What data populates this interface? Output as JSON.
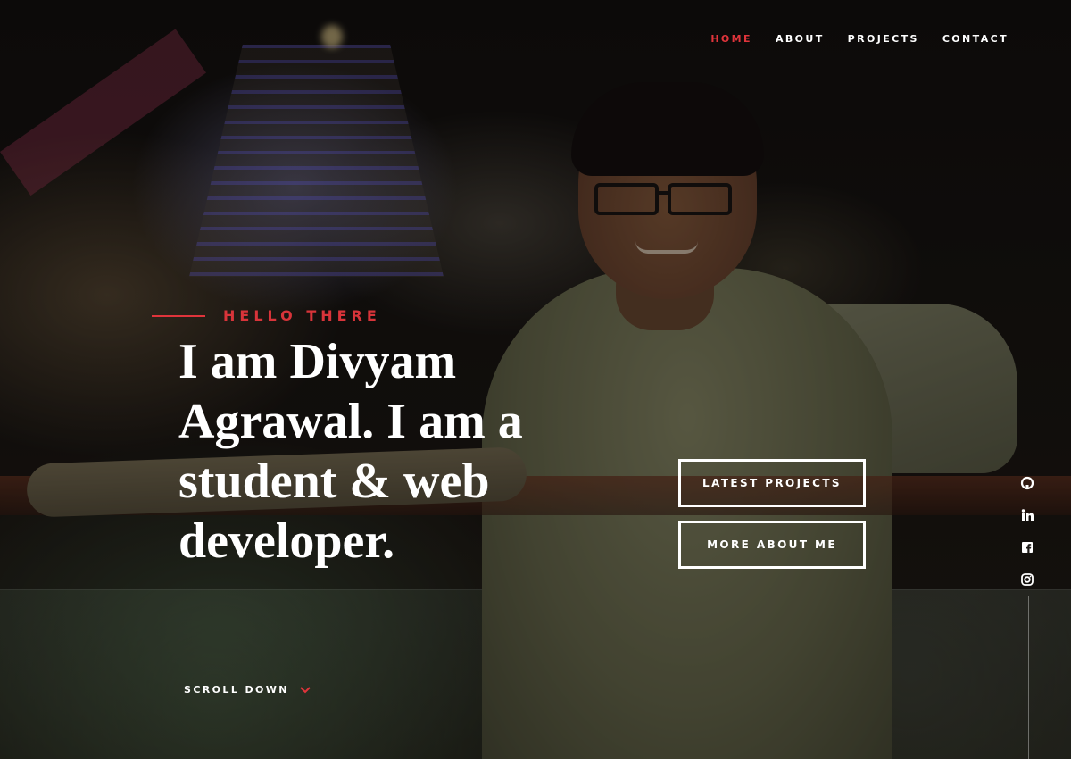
{
  "nav": {
    "items": [
      {
        "label": "HOME",
        "active": true
      },
      {
        "label": "ABOUT",
        "active": false
      },
      {
        "label": "PROJECTS",
        "active": false
      },
      {
        "label": "CONTACT",
        "active": false
      }
    ]
  },
  "hero": {
    "eyebrow": "HELLO THERE",
    "headline_lines": [
      "I am Divyam",
      "Agrawal. I am a",
      "student & web",
      "developer."
    ],
    "buttons": {
      "projects": "LATEST PROJECTS",
      "about": "MORE ABOUT ME"
    },
    "scroll_label": "SCROLL DOWN",
    "scroll_icon": "chevron-down-icon"
  },
  "social": {
    "icons": [
      "github-icon",
      "linkedin-icon",
      "facebook-icon",
      "instagram-icon"
    ]
  },
  "colors": {
    "accent": "#e0343b",
    "text": "#ffffff"
  }
}
